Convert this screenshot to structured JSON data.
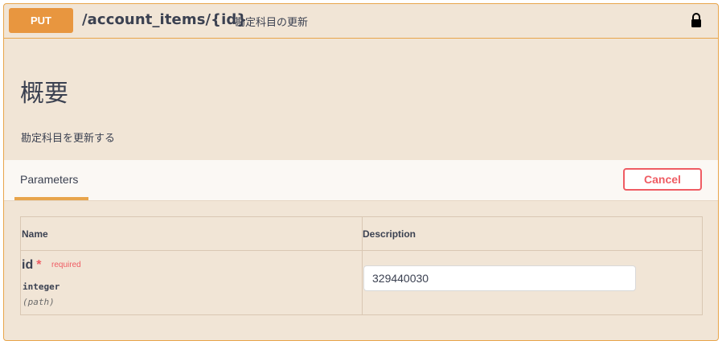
{
  "operation": {
    "method": "PUT",
    "path": "/account_items/{id}",
    "summary": "勘定科目の更新",
    "icons": {
      "lock": "lock-icon"
    }
  },
  "overview": {
    "title": "概要",
    "description": "勘定科目を更新する"
  },
  "parameters": {
    "tab_label": "Parameters",
    "cancel_label": "Cancel",
    "columns": {
      "name": "Name",
      "description": "Description"
    },
    "rows": [
      {
        "name": "id",
        "required_star": "*",
        "required_label": "required",
        "type": "integer",
        "in": "(path)",
        "value": "329440030"
      }
    ]
  },
  "colors": {
    "accent": "#e8a54b",
    "method_bg": "#e8963f",
    "cancel": "#ef5c63",
    "panel_bg": "#f1e5d6"
  }
}
